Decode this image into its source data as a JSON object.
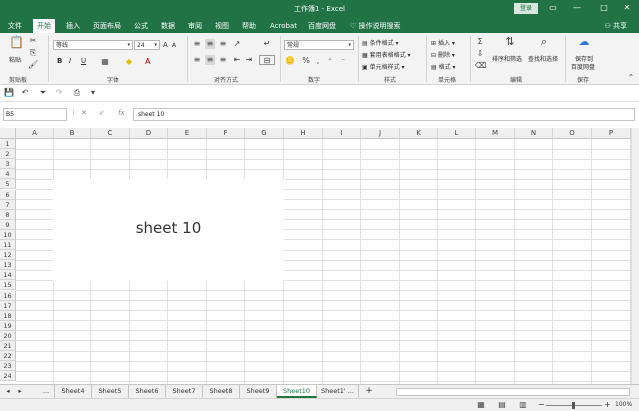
{
  "window": {
    "title": "工作簿1  -  Excel",
    "login_label": "登录",
    "minimize": "—",
    "restore": "▭",
    "maximize": "□",
    "close": "✕"
  },
  "menu": {
    "tabs": [
      "文件",
      "开始",
      "插入",
      "页面布局",
      "公式",
      "数据",
      "审阅",
      "视图",
      "帮助",
      "Acrobat",
      "百度网盘"
    ],
    "tell_me": "操作说明搜索",
    "share": "共享"
  },
  "ribbon": {
    "clipboard": {
      "paste": "粘贴",
      "label": "剪贴板"
    },
    "font": {
      "name": "等线",
      "size": "24",
      "bold": "B",
      "italic": "I",
      "underline": "U",
      "label": "字体",
      "font_color_glyph": "A",
      "grow": "A",
      "shrink": "A"
    },
    "alignment": {
      "label": "对齐方式"
    },
    "number": {
      "format": "常规",
      "label": "数字"
    },
    "styles": {
      "conditional": "条件格式",
      "table": "套用表格格式",
      "cell_styles": "单元格样式",
      "label": "样式"
    },
    "cells": {
      "insert": "插入",
      "delete": "删除",
      "format": "格式",
      "label": "单元格"
    },
    "editing": {
      "sort_filter": "排序和筛选",
      "find_select": "查找和选择",
      "label": "编辑"
    },
    "save": {
      "line1": "保存到",
      "line2": "百度网盘",
      "label": "保存"
    }
  },
  "formula_bar": {
    "name_box": "B5",
    "content": "sheet 10"
  },
  "grid": {
    "columns": [
      "A",
      "B",
      "C",
      "D",
      "E",
      "F",
      "G",
      "H",
      "I",
      "J",
      "K",
      "L",
      "M",
      "N",
      "O",
      "P"
    ],
    "rows": [
      "1",
      "2",
      "3",
      "4",
      "5",
      "6",
      "7",
      "8",
      "9",
      "10",
      "11",
      "12",
      "13",
      "14",
      "15",
      "16",
      "17",
      "18",
      "19",
      "20",
      "21",
      "22",
      "23",
      "24"
    ],
    "textbox_text": "sheet 10"
  },
  "sheets": {
    "nav_ellipsis": "...",
    "tabs": [
      "Sheet4",
      "Sheet5",
      "Sheet6",
      "Sheet7",
      "Sheet8",
      "Sheet9",
      "Sheet10",
      "Sheet1' ..."
    ],
    "active_tab": "Sheet10",
    "add": "+"
  },
  "status": {
    "zoom": "100%",
    "zoom_minus": "−",
    "zoom_plus": "+"
  },
  "colors": {
    "brand": "#217346"
  }
}
